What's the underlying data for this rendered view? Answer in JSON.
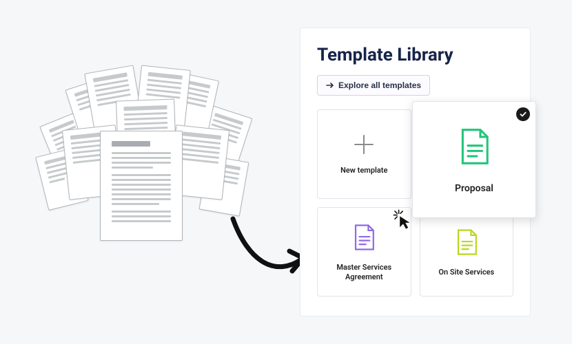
{
  "library": {
    "title": "Template Library",
    "explore_label": "Explore all templates",
    "cards": {
      "new": "New template",
      "proposal": "Proposal",
      "msa": "Master Services Agreement",
      "onsite": "On Site Services"
    }
  },
  "colors": {
    "proposal": "#22c57b",
    "msa": "#9168e8",
    "onsite": "#b7d81a"
  }
}
